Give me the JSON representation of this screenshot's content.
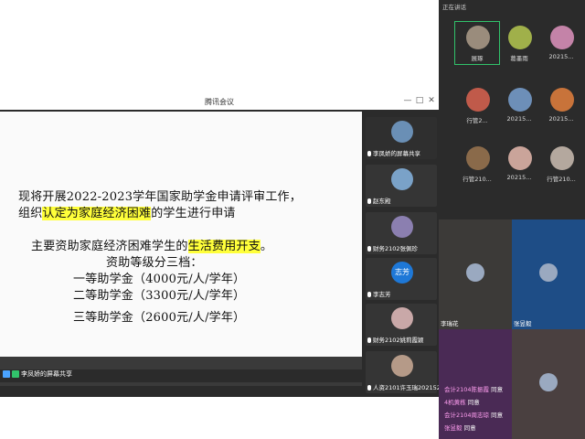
{
  "window": {
    "title": "腾讯会议",
    "min": "—",
    "restore": "□",
    "close": "✕"
  },
  "slide": {
    "line1": "现将开展2022-2023学年国家助学金申请评审工作，",
    "line2_pre": "组织",
    "line2_hl": "认定为家庭经济困难",
    "line2_post": "的学生进行申请",
    "line3_pre": "主要资助家庭经济困难学生的",
    "line3_hl": "生活费用开支",
    "line3_post": "。",
    "line4": "资助等级分三档：",
    "line5": "一等助学金（4000元/人/学年）",
    "line6": "二等助学金（3300元/人/学年）",
    "line7": "三等助学金（2600元/人/学年）"
  },
  "share_footer": "李凤娇的屏幕共享",
  "sidebar": [
    {
      "name": "李凤娇的屏幕共享",
      "color": "#6a8fb5"
    },
    {
      "name": "赵东殿",
      "color": "#7aa2c8"
    },
    {
      "name": "财务2102张佩珍",
      "color": "#8b7fb0"
    },
    {
      "name": "李志芳",
      "badge": "志芳",
      "color": "#1e78d7"
    },
    {
      "name": "财务2102姚莉霞颖",
      "color": "#c9a8a8"
    },
    {
      "name": "人资2101许玉瑞202152...",
      "color": "#b59a88"
    }
  ],
  "gallery": {
    "header": "正在讲话",
    "tiles": [
      {
        "name": "展琢",
        "color": "#9a8c7c"
      },
      {
        "name": "葛墨雨",
        "color": "#a0b04a"
      },
      {
        "name": "20215...",
        "color": "#c483a8"
      },
      {
        "name": "行管2...",
        "color": "#c05a4a"
      },
      {
        "name": "20215...",
        "color": "#6d8fb8"
      },
      {
        "name": "20215...",
        "color": "#c8733a"
      },
      {
        "name": "行管210...",
        "color": "#8a6a4a"
      },
      {
        "name": "20215...",
        "color": "#caa49a"
      },
      {
        "name": "行管210...",
        "color": "#b4a89e"
      }
    ]
  },
  "videos": [
    {
      "name": "李瑞花",
      "bg": "#3c3a38"
    },
    {
      "name": "张昱毅",
      "bg": "#1e4d86"
    },
    {
      "name": "",
      "bg": "#4a2a55"
    },
    {
      "name": "",
      "bg": "#4a4040"
    }
  ],
  "chat": [
    {
      "who": "会计2104陈振霞",
      "msg": "同意"
    },
    {
      "who": "4机黄栋",
      "msg": "同意"
    },
    {
      "who": "会计2104周志琼",
      "msg": "同意"
    },
    {
      "who": "张昱毅",
      "msg": "同意"
    }
  ]
}
